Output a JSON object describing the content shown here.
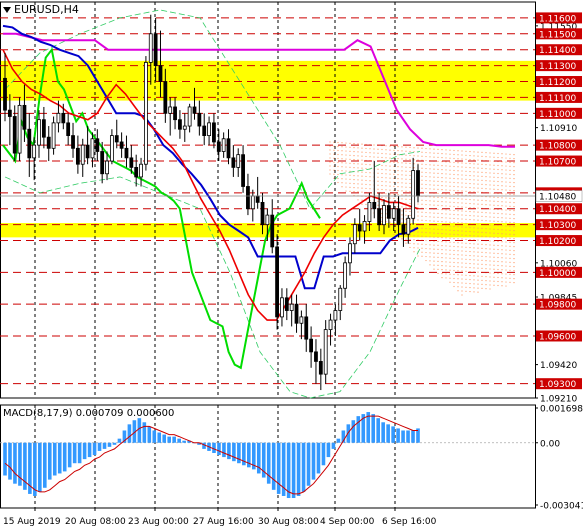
{
  "header": {
    "symbol": "EURUSD,H4",
    "macd_name": "MACD(8,17,9)",
    "macd_main": "0.000709",
    "macd_signal": "0.000600"
  },
  "colors": {
    "resistance_line": "#cc0000",
    "price_label_bg": "#cc0000",
    "zone_fill": "#ffff00",
    "green_line": "#00dd00",
    "blue_line": "#0000cc",
    "red_line": "#ee0000",
    "magenta_line": "#dd00dd",
    "cloud_dots": "#ff9966",
    "band_lines": "#33cc66",
    "macd_hist": "#3399ff",
    "macd_signal": "#cc0000"
  },
  "chart_data": {
    "type": "candlestick",
    "y_ticks_price": [
      "1.11600",
      "1.11550",
      "1.11500",
      "1.11400",
      "1.11300",
      "1.11200",
      "1.11100",
      "1.11000",
      "1.10910",
      "1.10800",
      "1.10700",
      "1.10500",
      "1.10480",
      "1.10400",
      "1.10300",
      "1.10200",
      "1.10060",
      "1.10000",
      "1.09845",
      "1.09800",
      "1.09600",
      "1.09420",
      "1.09300",
      "1.09210"
    ],
    "level_labels": [
      "1.11600",
      "1.11500",
      "1.11400",
      "1.11300",
      "1.11200",
      "1.11100",
      "1.11000",
      "1.10800",
      "1.10700",
      "1.10500",
      "1.10400",
      "1.10300",
      "1.10200",
      "1.10000",
      "1.09800",
      "1.09600",
      "1.09300"
    ],
    "current_price": "1.10480",
    "zones": [
      {
        "from": 1.1108,
        "to": 1.1133
      },
      {
        "from": 1.1022,
        "to": 1.1031
      }
    ],
    "ylim": [
      1.0921,
      1.117
    ],
    "x_tick_labels": [
      "15 Aug 2019",
      "20 Aug 08:00",
      "23 Aug 00:00",
      "27 Aug 16:00",
      "30 Aug 08:00",
      "4 Sep 00:00",
      "6 Sep 16:00"
    ],
    "candles": [
      [
        1.1122,
        1.1138,
        1.1095,
        1.1102
      ],
      [
        1.1102,
        1.1112,
        1.108,
        1.1098
      ],
      [
        1.1098,
        1.1105,
        1.107,
        1.1075
      ],
      [
        1.1075,
        1.111,
        1.107,
        1.1105
      ],
      [
        1.1105,
        1.1118,
        1.1082,
        1.109
      ],
      [
        1.109,
        1.11,
        1.106,
        1.1072
      ],
      [
        1.1072,
        1.1085,
        1.1058,
        1.108
      ],
      [
        1.108,
        1.1102,
        1.1072,
        1.1096
      ],
      [
        1.1096,
        1.1104,
        1.1078,
        1.1085
      ],
      [
        1.1085,
        1.1092,
        1.107,
        1.1078
      ],
      [
        1.1078,
        1.1098,
        1.1074,
        1.1094
      ],
      [
        1.1094,
        1.1108,
        1.1088,
        1.11
      ],
      [
        1.11,
        1.1106,
        1.109,
        1.1094
      ],
      [
        1.1094,
        1.11,
        1.108,
        1.1086
      ],
      [
        1.1086,
        1.1094,
        1.1072,
        1.1078
      ],
      [
        1.1078,
        1.1086,
        1.1062,
        1.1068
      ],
      [
        1.1068,
        1.1084,
        1.106,
        1.108
      ],
      [
        1.108,
        1.1092,
        1.1068,
        1.1072
      ],
      [
        1.1072,
        1.1088,
        1.1066,
        1.1084
      ],
      [
        1.1084,
        1.109,
        1.107,
        1.1076
      ],
      [
        1.1076,
        1.1082,
        1.1056,
        1.1062
      ],
      [
        1.1062,
        1.1076,
        1.1058,
        1.107
      ],
      [
        1.107,
        1.109,
        1.1068,
        1.1086
      ],
      [
        1.1086,
        1.1096,
        1.1078,
        1.1082
      ],
      [
        1.1082,
        1.1088,
        1.1072,
        1.1078
      ],
      [
        1.1078,
        1.1086,
        1.1066,
        1.1072
      ],
      [
        1.1072,
        1.108,
        1.1062,
        1.1066
      ],
      [
        1.1066,
        1.1074,
        1.1054,
        1.106
      ],
      [
        1.106,
        1.1072,
        1.1054,
        1.1068
      ],
      [
        1.1068,
        1.1136,
        1.1064,
        1.1132
      ],
      [
        1.1132,
        1.1162,
        1.1118,
        1.115
      ],
      [
        1.115,
        1.116,
        1.112,
        1.113
      ],
      [
        1.113,
        1.1152,
        1.111,
        1.112
      ],
      [
        1.112,
        1.1128,
        1.1094,
        1.11
      ],
      [
        1.11,
        1.111,
        1.1086,
        1.1104
      ],
      [
        1.1104,
        1.111,
        1.109,
        1.1096
      ],
      [
        1.1096,
        1.1102,
        1.1084,
        1.109
      ],
      [
        1.109,
        1.11,
        1.1082,
        1.1092
      ],
      [
        1.1092,
        1.1106,
        1.1088,
        1.1104
      ],
      [
        1.1104,
        1.1116,
        1.1096,
        1.11
      ],
      [
        1.11,
        1.1108,
        1.1086,
        1.1092
      ],
      [
        1.1092,
        1.11,
        1.108,
        1.1086
      ],
      [
        1.1086,
        1.1098,
        1.108,
        1.1094
      ],
      [
        1.1094,
        1.11,
        1.1078,
        1.1082
      ],
      [
        1.1082,
        1.109,
        1.107,
        1.1076
      ],
      [
        1.1076,
        1.1088,
        1.1072,
        1.1084
      ],
      [
        1.1084,
        1.109,
        1.1068,
        1.1072
      ],
      [
        1.1072,
        1.108,
        1.106,
        1.1066
      ],
      [
        1.1066,
        1.1078,
        1.106,
        1.1074
      ],
      [
        1.1074,
        1.108,
        1.105,
        1.1054
      ],
      [
        1.1054,
        1.1062,
        1.1036,
        1.104
      ],
      [
        1.104,
        1.1052,
        1.1032,
        1.1048
      ],
      [
        1.1048,
        1.106,
        1.104,
        1.1044
      ],
      [
        1.1044,
        1.105,
        1.1024,
        1.103
      ],
      [
        1.103,
        1.104,
        1.102,
        1.1036
      ],
      [
        1.1036,
        1.1046,
        1.1012,
        1.1016
      ],
      [
        1.1016,
        1.1024,
        1.0964,
        1.0972
      ],
      [
        1.0972,
        1.099,
        1.0966,
        1.0984
      ],
      [
        1.0984,
        1.099,
        1.097,
        1.0976
      ],
      [
        1.0976,
        1.0986,
        1.0966,
        1.098
      ],
      [
        1.098,
        1.0986,
        1.0962,
        1.0968
      ],
      [
        1.0968,
        1.0976,
        1.0958,
        1.0972
      ],
      [
        1.0972,
        1.098,
        1.095,
        1.0958
      ],
      [
        1.0958,
        1.0966,
        1.094,
        1.095
      ],
      [
        1.095,
        1.0958,
        1.093,
        1.0944
      ],
      [
        1.0944,
        1.0952,
        1.0926,
        1.0936
      ],
      [
        1.0936,
        1.097,
        1.093,
        1.0964
      ],
      [
        1.0964,
        1.0974,
        1.0954,
        1.097
      ],
      [
        1.097,
        1.098,
        1.096,
        1.0976
      ],
      [
        1.0976,
        1.0992,
        1.097,
        1.099
      ],
      [
        1.099,
        1.101,
        1.0984,
        1.1006
      ],
      [
        1.1006,
        1.1022,
        1.0998,
        1.1018
      ],
      [
        1.1018,
        1.1034,
        1.1012,
        1.103
      ],
      [
        1.103,
        1.104,
        1.102,
        1.1026
      ],
      [
        1.1026,
        1.1036,
        1.1018,
        1.1032
      ],
      [
        1.1032,
        1.105,
        1.1026,
        1.1044
      ],
      [
        1.1044,
        1.107,
        1.1034,
        1.104
      ],
      [
        1.104,
        1.105,
        1.1026,
        1.103
      ],
      [
        1.103,
        1.1046,
        1.1024,
        1.1042
      ],
      [
        1.1042,
        1.105,
        1.1028,
        1.1034
      ],
      [
        1.1034,
        1.1044,
        1.1026,
        1.104
      ],
      [
        1.104,
        1.1048,
        1.1022,
        1.103
      ],
      [
        1.103,
        1.104,
        1.1016,
        1.1024
      ],
      [
        1.1024,
        1.1036,
        1.1018,
        1.1034
      ],
      [
        1.1034,
        1.1072,
        1.103,
        1.1064
      ],
      [
        1.1064,
        1.1068,
        1.1044,
        1.1048
      ]
    ],
    "lines": {
      "green": [
        1.108,
        1.1075,
        1.107,
        1.1095,
        1.1085,
        1.108,
        1.111,
        1.1135,
        1.114,
        1.112,
        1.1115,
        1.1105,
        1.1095,
        1.11,
        1.109,
        1.1085,
        1.108,
        1.1075,
        1.107,
        1.1068,
        1.1066,
        1.1064,
        1.106,
        1.1058,
        1.1056,
        1.1054,
        1.105,
        1.1048,
        1.1045,
        1.104,
        1.102,
        1.1,
        1.099,
        1.098,
        1.097,
        1.0968,
        1.0966,
        1.095,
        1.0942,
        1.094,
        1.096,
        1.098,
        1.1,
        1.102,
        1.103,
        1.1036,
        1.1038,
        1.104,
        1.1048,
        1.1056,
        1.1046,
        1.104,
        1.1034
      ],
      "blue": [
        1.1155,
        1.1154,
        1.115,
        1.1148,
        1.1145,
        1.1143,
        1.114,
        1.1138,
        1.1136,
        1.113,
        1.112,
        1.111,
        1.11,
        1.11,
        1.11,
        1.1098,
        1.109,
        1.108,
        1.1075,
        1.1068,
        1.1062,
        1.1055,
        1.1046,
        1.1036,
        1.103,
        1.1026,
        1.1022,
        1.101,
        1.101,
        1.101,
        1.101,
        1.101,
        1.099,
        1.099,
        1.101,
        1.101,
        1.1012,
        1.1012,
        1.1012,
        1.1012,
        1.1012,
        1.102,
        1.1024,
        1.1025,
        1.1028
      ],
      "red": [
        1.114,
        1.1128,
        1.112,
        1.1115,
        1.1112,
        1.1108,
        1.1105,
        1.11,
        1.1098,
        1.1096,
        1.11,
        1.111,
        1.1118,
        1.1112,
        1.1104,
        1.1096,
        1.109,
        1.1084,
        1.1078,
        1.107,
        1.1058,
        1.1046,
        1.1036,
        1.1026,
        1.1014,
        1.1,
        1.0986,
        1.0976,
        1.097,
        1.097,
        1.098,
        1.099,
        1.1,
        1.1012,
        1.1022,
        1.103,
        1.1036,
        1.104,
        1.1044,
        1.1048,
        1.1046,
        1.1044,
        1.1044,
        1.1042,
        1.104
      ],
      "magenta": [
        1.115,
        1.115,
        1.1148,
        1.1146,
        1.1146,
        1.1146,
        1.1146,
        1.1146,
        1.114,
        1.114,
        1.114,
        1.114,
        1.114,
        1.114,
        1.114,
        1.114,
        1.114,
        1.114,
        1.114,
        1.114,
        1.114,
        1.114,
        1.114,
        1.114,
        1.114,
        1.114,
        1.114,
        1.1146,
        1.1142,
        1.1122,
        1.1102,
        1.109,
        1.1082,
        1.108,
        1.108,
        1.108,
        1.108,
        1.108,
        1.1079,
        1.1079
      ]
    },
    "macd": {
      "ylim": [
        -0.003041,
        0.001698
      ],
      "y_ticks": [
        "0.001698",
        "0.00",
        "-0.003041"
      ],
      "histogram": [
        -0.0016,
        -0.0018,
        -0.002,
        -0.0021,
        -0.0023,
        -0.0025,
        -0.0026,
        -0.0024,
        -0.0022,
        -0.0018,
        -0.0016,
        -0.0015,
        -0.0014,
        -0.0012,
        -0.001,
        -0.001,
        -0.0008,
        -0.0007,
        -0.0006,
        -0.0004,
        -0.0003,
        -0.0002,
        -0.0001,
        0.0002,
        0.0006,
        0.0009,
        0.0011,
        0.0012,
        0.001,
        0.0008,
        0.0006,
        0.0005,
        0.0004,
        0.0003,
        0.0003,
        0.0002,
        0.0001,
        0.0001,
        0.0,
        -0.0001,
        -0.0003,
        -0.0004,
        -0.0005,
        -0.0006,
        -0.0007,
        -0.0008,
        -0.0009,
        -0.001,
        -0.0011,
        -0.0012,
        -0.0013,
        -0.0015,
        -0.0017,
        -0.002,
        -0.0023,
        -0.0025,
        -0.0026,
        -0.0027,
        -0.0027,
        -0.0026,
        -0.0024,
        -0.0021,
        -0.0018,
        -0.0015,
        -0.0011,
        -0.0007,
        -0.0003,
        0.0002,
        0.0006,
        0.0009,
        0.0011,
        0.0013,
        0.0014,
        0.0015,
        0.0014,
        0.0012,
        0.001,
        0.0009,
        0.0008,
        0.0007,
        0.0006,
        0.0006,
        0.0006,
        0.0007
      ],
      "signal": [
        -0.001,
        -0.0012,
        -0.0015,
        -0.0017,
        -0.0019,
        -0.0021,
        -0.0023,
        -0.0024,
        -0.0024,
        -0.0023,
        -0.0021,
        -0.0019,
        -0.0018,
        -0.0016,
        -0.0014,
        -0.0013,
        -0.0011,
        -0.001,
        -0.0008,
        -0.0007,
        -0.0005,
        -0.0004,
        -0.0003,
        -0.0001,
        0.0001,
        0.0003,
        0.0005,
        0.0007,
        0.0008,
        0.0008,
        0.0007,
        0.0006,
        0.0005,
        0.0004,
        0.0004,
        0.0003,
        0.0002,
        0.0001,
        0.0,
        0.0,
        -0.0001,
        -0.0002,
        -0.0003,
        -0.0004,
        -0.0005,
        -0.0006,
        -0.0007,
        -0.0008,
        -0.0009,
        -0.001,
        -0.0011,
        -0.0012,
        -0.0014,
        -0.0016,
        -0.0018,
        -0.002,
        -0.0022,
        -0.0024,
        -0.0025,
        -0.0025,
        -0.0024,
        -0.0022,
        -0.002,
        -0.0017,
        -0.0014,
        -0.0011,
        -0.0007,
        -0.0003,
        0.0001,
        0.0005,
        0.0008,
        0.001,
        0.0012,
        0.0013,
        0.0013,
        0.0013,
        0.0012,
        0.0011,
        0.001,
        0.0009,
        0.0008,
        0.0007,
        0.0006,
        0.0006
      ]
    }
  }
}
